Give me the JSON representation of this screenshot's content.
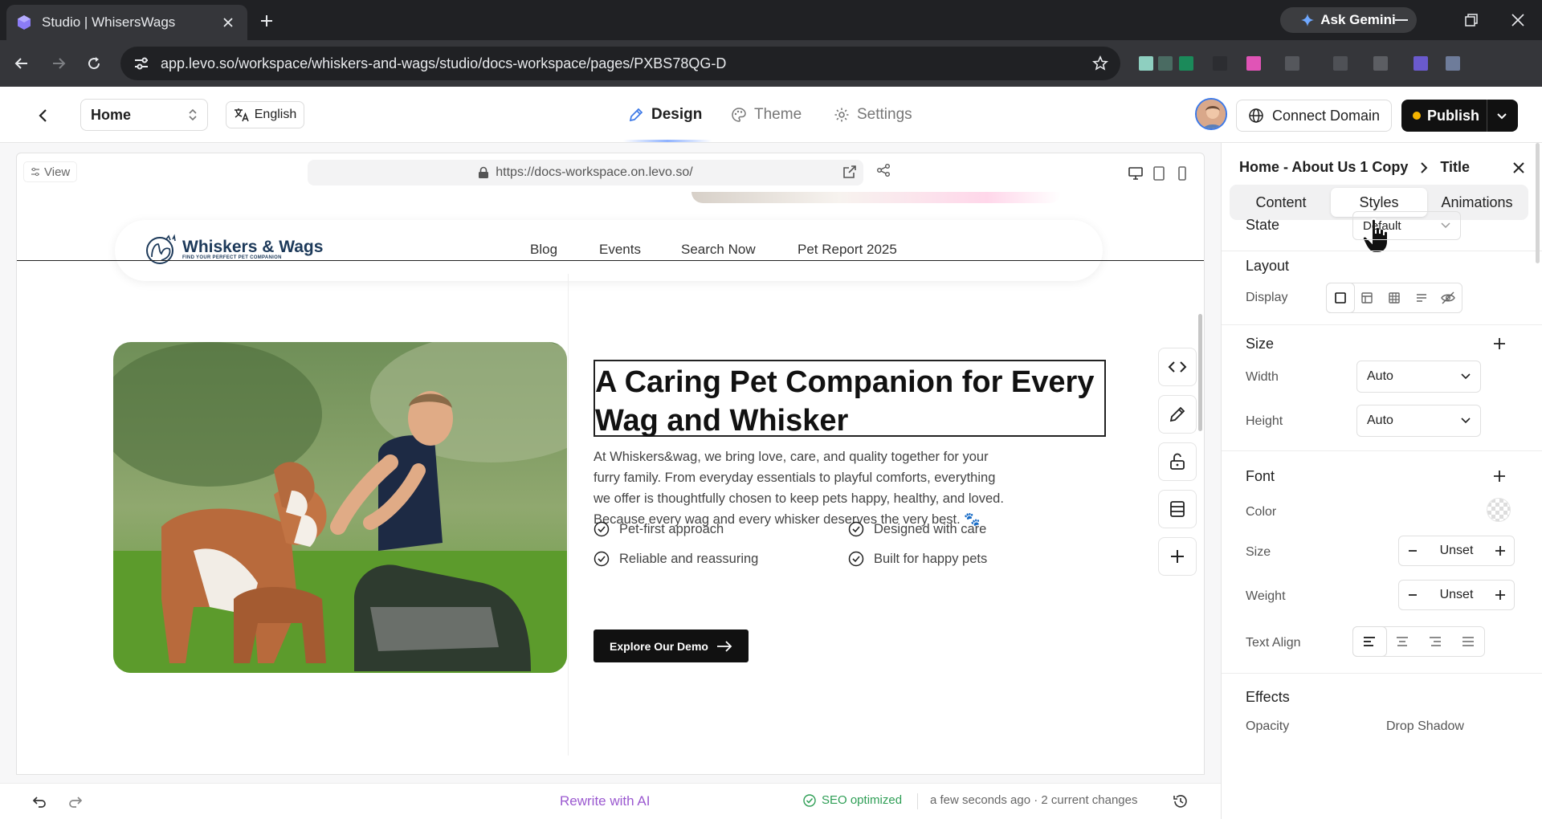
{
  "browser": {
    "tab_title": "Studio | WhisersWags",
    "gemini_label": "Ask Gemini",
    "url": "app.levo.so/workspace/whiskers-and-wags/studio/docs-workspace/pages/PXBS78QG-D"
  },
  "topbar": {
    "page": "Home",
    "language": "English",
    "modes": [
      "Design",
      "Theme",
      "Settings"
    ],
    "connect_domain": "Connect Domain",
    "publish": "Publish"
  },
  "canvas": {
    "view_label": "View",
    "preview_url": "https://docs-workspace.on.levo.so/",
    "site": {
      "brand": "Whiskers & Wags",
      "tagline": "FIND YOUR PERFECT PET COMPANION",
      "nav": [
        "Blog",
        "Events",
        "Search Now",
        "Pet Report 2025"
      ],
      "heading": "A Caring Pet Companion for Every Wag and Whisker",
      "description": "At Whiskers&wag, we bring love, care, and quality together for your furry family. From everyday essentials to playful comforts, everything we offer is thoughtfully chosen to keep pets happy, healthy, and loved.",
      "description2": "Because every wag and every whisker deserves the very best. 🐾",
      "features": [
        "Pet-first approach",
        "Designed with care",
        "Reliable and reassuring",
        "Built for happy pets"
      ],
      "cta": "Explore Our Demo"
    }
  },
  "bottombar": {
    "rewrite": "Rewrite with AI",
    "seo": "SEO optimized",
    "status": "a few seconds ago · 2 current changes"
  },
  "panel": {
    "breadcrumb_parent": "Home - About Us 1 Copy",
    "breadcrumb_current": "Title",
    "tabs": [
      "Content",
      "Styles",
      "Animations"
    ],
    "state_label": "State",
    "state_value": "Default",
    "layout": {
      "title": "Layout",
      "display_label": "Display"
    },
    "size": {
      "title": "Size",
      "width_label": "Width",
      "width_value": "Auto",
      "height_label": "Height",
      "height_value": "Auto"
    },
    "font": {
      "title": "Font",
      "color_label": "Color",
      "size_label": "Size",
      "size_value": "Unset",
      "weight_label": "Weight",
      "weight_value": "Unset",
      "align_label": "Text Align"
    },
    "effects": {
      "title": "Effects",
      "opacity_label": "Opacity",
      "shadow_label": "Drop Shadow"
    }
  },
  "colors": {
    "accent_ai": "#9b59d0",
    "seo_green": "#2e9e55",
    "publish_dot": "#f5b400"
  }
}
